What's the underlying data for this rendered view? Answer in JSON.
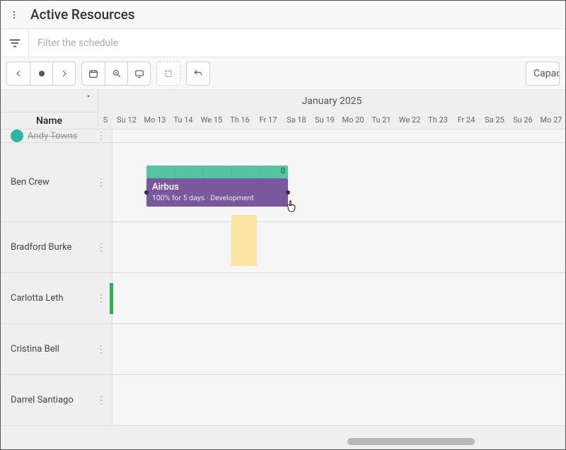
{
  "header": {
    "title": "Active Resources"
  },
  "filter": {
    "placeholder": "Filter the schedule"
  },
  "toolbar": {
    "capacity_label": "Capacity"
  },
  "timeline": {
    "month_label": "January 2025",
    "name_column_label": "Name",
    "days": [
      "S",
      "Su 12",
      "Mo 13",
      "Tu 14",
      "We 15",
      "Th 16",
      "Fr 17",
      "Sa 18",
      "Su 19",
      "Mo 20",
      "Tu 21",
      "We 22",
      "Th 23",
      "Fr 24",
      "Sa 25",
      "Su 26",
      "Mo 27"
    ]
  },
  "resources": [
    {
      "name": "Andy Towns"
    },
    {
      "name": "Ben Crew"
    },
    {
      "name": "Bradford Burke"
    },
    {
      "name": "Carlotta Leth"
    },
    {
      "name": "Cristina Bell"
    },
    {
      "name": "Darrel Santiago"
    }
  ],
  "task": {
    "title": "Airbus",
    "subtitle": "100% for 5 days · Development",
    "util_badge": "0"
  },
  "colors": {
    "task_bg": "#7a589b",
    "util_bg": "#55c3a0",
    "yellow": "#fbe3a2",
    "green": "#2bb24c"
  }
}
